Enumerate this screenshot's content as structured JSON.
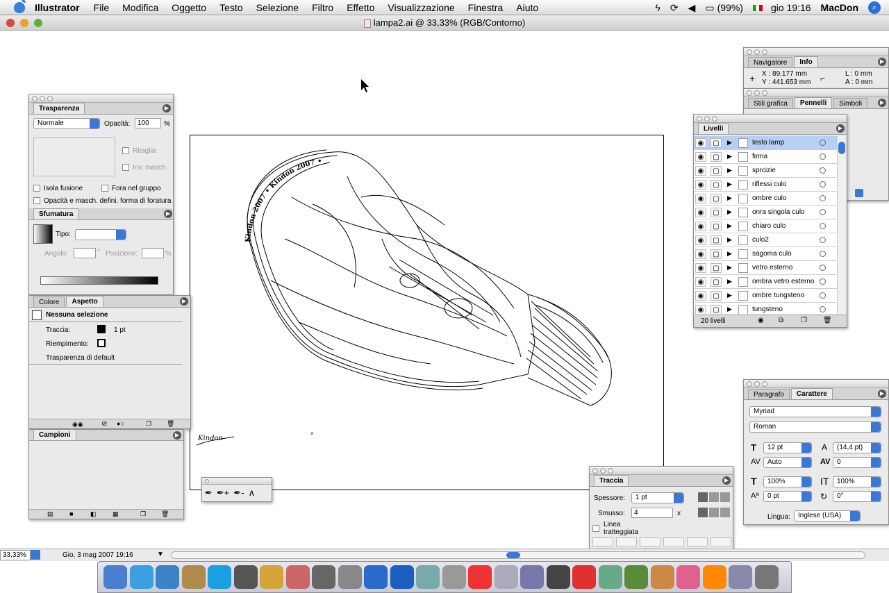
{
  "menubar": {
    "app": "Illustrator",
    "items": [
      "File",
      "Modifica",
      "Oggetto",
      "Testo",
      "Selezione",
      "Filtro",
      "Effetto",
      "Visualizzazione",
      "Finestra",
      "Aiuto"
    ],
    "battery": "(99%)",
    "clock": "gio 19:16",
    "user": "MacDon"
  },
  "window": {
    "title": "lampa2.ai @ 33,33% (RGB/Contorno)"
  },
  "transparency": {
    "tab": "Trasparenza",
    "mode": "Normale",
    "opacity_label": "Opacità:",
    "opacity_value": "100",
    "pct": "%",
    "clip": "Ritaglia",
    "invert": "Inv. masch.",
    "isolate": "Isola fusione",
    "knockout": "Fora nel gruppo",
    "opacity_mask": "Opacità e masch. defini. forma di foratura"
  },
  "gradient": {
    "tab": "Sfumatura",
    "type_label": "Tipo:",
    "angle_label": "Angolo:",
    "deg": "°",
    "position_label": "Posizione:",
    "pct": "%"
  },
  "appearance": {
    "tab_color": "Colore",
    "tab_appearance": "Aspetto",
    "no_selection": "Nessuna selezione",
    "stroke_label": "Traccia:",
    "stroke_value": "1 pt",
    "fill_label": "Riempimento:",
    "default_transparency": "Trasparenza di default"
  },
  "swatches": {
    "tab": "Campioni"
  },
  "navinfo": {
    "tab_nav": "Navigatore",
    "tab_info": "Info",
    "x": "X : 89.177 mm",
    "y": "Y : 441.653 mm",
    "l": "L : 0 mm",
    "a": "A : 0 mm"
  },
  "brushes": {
    "tab_styles": "Stili grafica",
    "tab_brushes": "Pennelli",
    "tab_symbols": "Simboli"
  },
  "layers": {
    "tab": "Livelli",
    "count": "20 livelli",
    "items": [
      "testo lamp",
      "firma",
      "sprcizie",
      "riflessi culo",
      "ombre culo",
      "onra singola culo",
      "chiaro culo",
      "culo2",
      "sagoma culo",
      "vetro esterno",
      "ombra vetro esterno",
      "ombre tungsteno",
      "tungsteno"
    ]
  },
  "character": {
    "tab_para": "Paragrafo",
    "tab_char": "Carattere",
    "font": "Myriad",
    "style": "Roman",
    "size": "12 pt",
    "leading": "(14,4 pt)",
    "kerning": "Auto",
    "tracking": "0",
    "vscale": "100%",
    "hscale": "100%",
    "baseline": "0 pt",
    "rotation": "0°",
    "language_label": "Lingua:",
    "language": "Inglese (USA)"
  },
  "stroke": {
    "tab": "Traccia",
    "weight_label": "Spessore:",
    "weight": "1 pt",
    "miter_label": "Smusso:",
    "miter": "4",
    "x": "x",
    "dashed": "Linea tratteggiata",
    "dash_labels": [
      "trat.",
      "spa",
      "trat.",
      "spa",
      "trat.",
      "spa"
    ]
  },
  "status": {
    "zoom": "33,33%",
    "date": "Gio, 3 mag 2007  19:16"
  },
  "artwork": {
    "arc_text": "Kindon 2007 • Kindon 2007 • ",
    "signature": "Kindon"
  }
}
